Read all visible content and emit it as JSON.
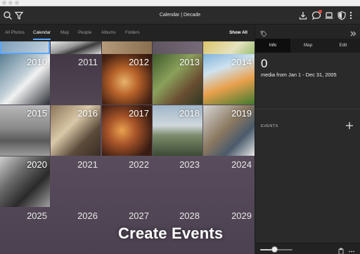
{
  "window": {
    "title": "Calendar | Decade"
  },
  "toolbar": {
    "left_icons": [
      "search-icon",
      "filter-icon"
    ],
    "right_icons": [
      "import-icon",
      "chat-icon",
      "laptop-icon",
      "shield-icon",
      "more-icon"
    ],
    "notification_color": "#e0463c"
  },
  "nav": {
    "items": [
      {
        "label": "All Photos",
        "active": false
      },
      {
        "label": "Calendar",
        "active": true
      },
      {
        "label": "Map",
        "active": false
      },
      {
        "label": "People",
        "active": false
      },
      {
        "label": "Albums",
        "active": false
      },
      {
        "label": "Folders",
        "active": false
      }
    ],
    "show_all": "Show All",
    "accent": "#5aa7ff"
  },
  "grid": {
    "years": [
      {
        "year": "2010",
        "has_photo": true
      },
      {
        "year": "2011",
        "has_photo": false
      },
      {
        "year": "2012",
        "has_photo": true
      },
      {
        "year": "2013",
        "has_photo": true
      },
      {
        "year": "2014",
        "has_photo": true
      },
      {
        "year": "2015",
        "has_photo": true
      },
      {
        "year": "2016",
        "has_photo": true
      },
      {
        "year": "2017",
        "has_photo": true
      },
      {
        "year": "2018",
        "has_photo": true
      },
      {
        "year": "2019",
        "has_photo": true
      },
      {
        "year": "2020",
        "has_photo": true
      },
      {
        "year": "2021",
        "has_photo": false
      },
      {
        "year": "2022",
        "has_photo": false
      },
      {
        "year": "2023",
        "has_photo": false
      },
      {
        "year": "2024",
        "has_photo": false
      },
      {
        "year": "2025",
        "has_photo": false
      },
      {
        "year": "2026",
        "has_photo": false
      },
      {
        "year": "2027",
        "has_photo": false
      },
      {
        "year": "2028",
        "has_photo": false
      },
      {
        "year": "2029",
        "has_photo": false
      }
    ]
  },
  "overlay_caption": "Create Events",
  "panel": {
    "tabs": [
      {
        "label": "Info",
        "active": true
      },
      {
        "label": "Map",
        "active": false
      },
      {
        "label": "Edit",
        "active": false
      }
    ],
    "count": "0",
    "range_text": "media from Jan 1 - Dec 31, 2005",
    "events_label": "EVENTS",
    "add_icon": "plus-icon",
    "tag_icon": "tag-icon",
    "collapse_icon": "chevron-right-double-icon"
  },
  "bottom": {
    "zoom_level": 0.45,
    "icons": [
      "clipboard-icon",
      "more-horizontal-icon"
    ]
  }
}
